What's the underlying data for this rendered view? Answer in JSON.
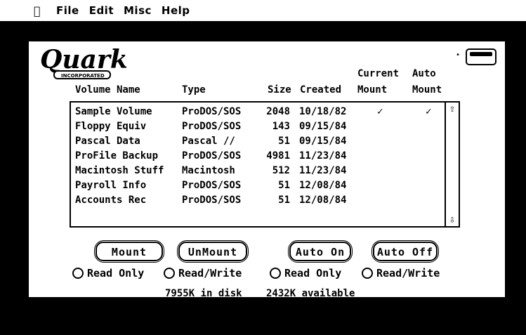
{
  "menubar": {
    "apple": "",
    "items": [
      "File",
      "Edit",
      "Misc",
      "Help"
    ]
  },
  "window": {
    "logo": {
      "text": "Quark",
      "sub": "INCORPORATED"
    },
    "columns": {
      "volume": "Volume Name",
      "type": "Type",
      "size": "Size",
      "created": "Created",
      "current_mount_1": "Current",
      "current_mount_2": "Mount",
      "auto_mount_1": "Auto",
      "auto_mount_2": "Mount"
    },
    "rows": [
      {
        "name": "Sample Volume",
        "type": "ProDOS/SOS",
        "size": "2048",
        "created": "10/18/82",
        "current": "✓",
        "auto": "✓"
      },
      {
        "name": "Floppy Equiv",
        "type": "ProDOS/SOS",
        "size": "143",
        "created": "09/15/84",
        "current": "",
        "auto": ""
      },
      {
        "name": "Pascal Data",
        "type": "Pascal //",
        "size": "51",
        "created": "09/15/84",
        "current": "",
        "auto": ""
      },
      {
        "name": "ProFile Backup",
        "type": "ProDOS/SOS",
        "size": "4981",
        "created": "11/23/84",
        "current": "",
        "auto": ""
      },
      {
        "name": "Macintosh Stuff",
        "type": "Macintosh",
        "size": "512",
        "created": "11/23/84",
        "current": "",
        "auto": ""
      },
      {
        "name": "Payroll Info",
        "type": "ProDOS/SOS",
        "size": "51",
        "created": "12/08/84",
        "current": "",
        "auto": ""
      },
      {
        "name": "Accounts Rec",
        "type": "ProDOS/SOS",
        "size": "51",
        "created": "12/08/84",
        "current": "",
        "auto": ""
      }
    ],
    "buttons": {
      "mount": "Mount",
      "unmount": "UnMount",
      "auto_on": "Auto On",
      "auto_off": "Auto Off"
    },
    "radios": {
      "read_only_1": "Read Only",
      "read_write_1": "Read/Write",
      "read_only_2": "Read Only",
      "read_write_2": "Read/Write"
    },
    "status": {
      "in_disk": "7955K in disk",
      "available": "2432K available"
    }
  }
}
